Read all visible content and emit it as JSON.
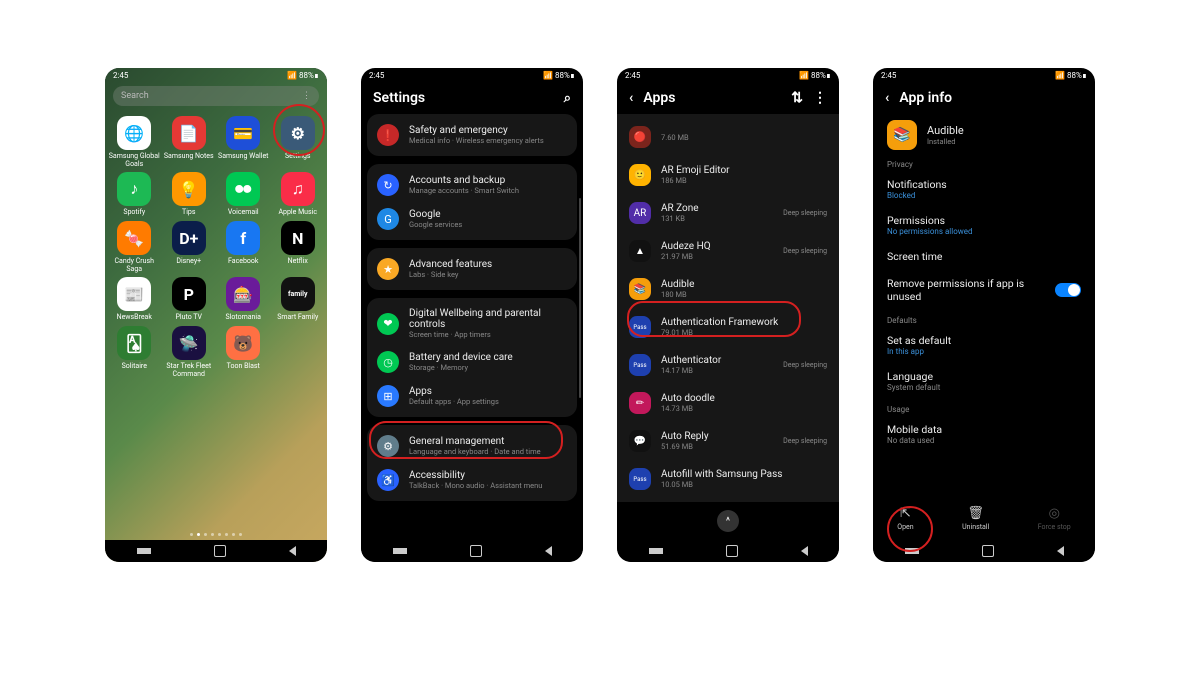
{
  "status": {
    "time": "2:45",
    "icons": "📶 88%∎"
  },
  "navbar": {
    "recent": "recent",
    "home": "home",
    "back": "back"
  },
  "phone1": {
    "search_placeholder": "Search",
    "highlight": "settings",
    "apps": [
      {
        "name": "Samsung Global Goals",
        "bg": "#fff",
        "glyph": "🌐"
      },
      {
        "name": "Samsung Notes",
        "bg": "#e53935",
        "glyph": "📄"
      },
      {
        "name": "Samsung Wallet",
        "bg": "#1e4fd8",
        "glyph": "💳"
      },
      {
        "name": "Settings",
        "bg": "#3a5a78",
        "glyph": "⚙"
      },
      {
        "name": "Spotify",
        "bg": "#1db954",
        "glyph": "♪"
      },
      {
        "name": "Tips",
        "bg": "#ff9800",
        "glyph": "💡"
      },
      {
        "name": "Voicemail",
        "bg": "#00c853",
        "glyph": "⏺⏺"
      },
      {
        "name": "Apple Music",
        "bg": "#fa2d48",
        "glyph": "♫"
      },
      {
        "name": "Candy Crush Saga",
        "bg": "#ff7b00",
        "glyph": "🍬"
      },
      {
        "name": "Disney+",
        "bg": "#0b1e4a",
        "glyph": "D+"
      },
      {
        "name": "Facebook",
        "bg": "#1877f2",
        "glyph": "f"
      },
      {
        "name": "Netflix",
        "bg": "#000",
        "glyph": "N"
      },
      {
        "name": "NewsBreak",
        "bg": "#fff",
        "glyph": "📰"
      },
      {
        "name": "Pluto TV",
        "bg": "#000",
        "glyph": "P"
      },
      {
        "name": "Slotomania",
        "bg": "#6a1b9a",
        "glyph": "🎰"
      },
      {
        "name": "Smart Family",
        "bg": "#111",
        "glyph": "family"
      },
      {
        "name": "Solitaire",
        "bg": "#2e7d32",
        "glyph": "🂡"
      },
      {
        "name": "Star Trek Fleet Command",
        "bg": "#1a1040",
        "glyph": "🛸"
      },
      {
        "name": "Toon Blast",
        "bg": "#ff7043",
        "glyph": "🐻"
      }
    ]
  },
  "phone2": {
    "title": "Settings",
    "highlight_index": 7,
    "rows": [
      {
        "icon_bg": "#c62828",
        "glyph": "❗",
        "title": "Safety and emergency",
        "sub": "Medical info · Wireless emergency alerts"
      },
      {
        "sep": true
      },
      {
        "icon_bg": "#2962ff",
        "glyph": "↻",
        "title": "Accounts and backup",
        "sub": "Manage accounts · Smart Switch"
      },
      {
        "icon_bg": "#1e88e5",
        "glyph": "G",
        "title": "Google",
        "sub": "Google services"
      },
      {
        "sep": true
      },
      {
        "icon_bg": "#f9a825",
        "glyph": "★",
        "title": "Advanced features",
        "sub": "Labs · Side key"
      },
      {
        "sep": true
      },
      {
        "icon_bg": "#00c853",
        "glyph": "❤",
        "title": "Digital Wellbeing and parental controls",
        "sub": "Screen time · App timers"
      },
      {
        "icon_bg": "#00c853",
        "glyph": "◷",
        "title": "Battery and device care",
        "sub": "Storage · Memory"
      },
      {
        "icon_bg": "#2979ff",
        "glyph": "⊞",
        "title": "Apps",
        "sub": "Default apps · App settings"
      },
      {
        "sep": true
      },
      {
        "icon_bg": "#607d8b",
        "glyph": "⚙",
        "title": "General management",
        "sub": "Language and keyboard · Date and time"
      },
      {
        "icon_bg": "#2962ff",
        "glyph": "♿",
        "title": "Accessibility",
        "sub": "TalkBack · Mono audio · Assistant menu"
      }
    ]
  },
  "phone3": {
    "title": "Apps",
    "highlight_index": 4,
    "rows": [
      {
        "icon_bg": "#7b241c",
        "glyph": "🔴",
        "title": "",
        "sub": "7.60 MB"
      },
      {
        "icon_bg": "#ffb300",
        "glyph": "🙂",
        "title": "AR Emoji Editor",
        "sub": "186 MB"
      },
      {
        "icon_bg": "#512da8",
        "glyph": "AR",
        "title": "AR Zone",
        "sub": "131 KB",
        "right": "Deep sleeping"
      },
      {
        "icon_bg": "#111",
        "glyph": "▲",
        "title": "Audeze HQ",
        "sub": "21.97 MB",
        "right": "Deep sleeping"
      },
      {
        "icon_bg": "#f59e0b",
        "glyph": "📚",
        "title": "Audible",
        "sub": "180 MB"
      },
      {
        "icon_bg": "#1e40af",
        "glyph": "Pass",
        "title": "Authentication Framework",
        "sub": "79.01 MB"
      },
      {
        "icon_bg": "#1e40af",
        "glyph": "Pass",
        "title": "Authenticator",
        "sub": "14.17 MB",
        "right": "Deep sleeping"
      },
      {
        "icon_bg": "#c2185b",
        "glyph": "✏",
        "title": "Auto doodle",
        "sub": "14.73 MB"
      },
      {
        "icon_bg": "#111",
        "glyph": "💬",
        "title": "Auto Reply",
        "sub": "51.69 MB",
        "right": "Deep sleeping"
      },
      {
        "icon_bg": "#1e40af",
        "glyph": "Pass",
        "title": "Autofill with Samsung Pass",
        "sub": "10.05 MB"
      }
    ]
  },
  "phone4": {
    "title": "App info",
    "app_name": "Audible",
    "app_status": "Installed",
    "sections": {
      "privacy": "Privacy",
      "defaults": "Defaults",
      "usage": "Usage"
    },
    "rows": {
      "notifications": {
        "title": "Notifications",
        "sub": "Blocked",
        "sub_color": "blue"
      },
      "permissions": {
        "title": "Permissions",
        "sub": "No permissions allowed",
        "sub_color": "blue"
      },
      "screen_time": {
        "title": "Screen time"
      },
      "remove_perms": {
        "title": "Remove permissions if app is unused",
        "toggle": true
      },
      "set_default": {
        "title": "Set as default",
        "sub": "In this app",
        "sub_color": "blue"
      },
      "language": {
        "title": "Language",
        "sub": "System default",
        "sub_color": "gray"
      },
      "mobile_data": {
        "title": "Mobile data",
        "sub": "No data used",
        "sub_color": "gray"
      }
    },
    "actions": {
      "open": "Open",
      "uninstall": "Uninstall",
      "force_stop": "Force stop"
    },
    "highlight": "open"
  }
}
